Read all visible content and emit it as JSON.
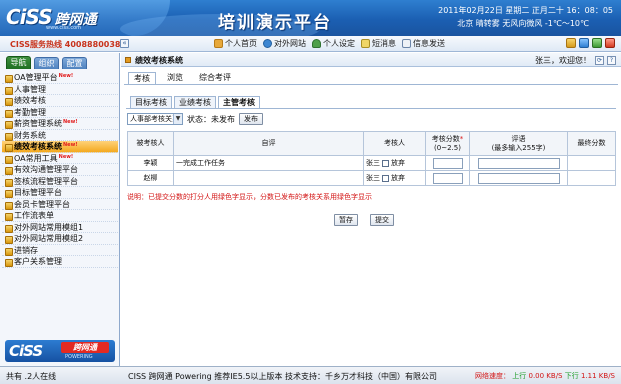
{
  "header": {
    "logo_en": "CiSS",
    "logo_cn": "跨网通",
    "logo_url": "www.ciss.com",
    "platform_title": "培训演示平台",
    "datetime": "2011年02月22日  星期二  正月二十  16：08：05",
    "weather": "北京  晴转雾  无风向微风  -1℃～10℃"
  },
  "toolbar": {
    "hotline": "CISS服务热线  4008880038",
    "collapse": "«",
    "links": [
      {
        "label": "个人首页",
        "icon": "home-icon"
      },
      {
        "label": "对外网站",
        "icon": "globe-icon"
      },
      {
        "label": "个人设定",
        "icon": "user-settings-icon"
      },
      {
        "label": "短消息",
        "icon": "message-icon"
      },
      {
        "label": "信息发送",
        "icon": "mail-icon"
      }
    ]
  },
  "sidebar": {
    "tabs": [
      "导航",
      "组织",
      "配置"
    ],
    "new_tag": "New!",
    "items": [
      {
        "label": "OA管理平台",
        "new": true
      },
      {
        "label": "人事管理"
      },
      {
        "label": "绩效考核"
      },
      {
        "label": "考勤管理"
      },
      {
        "label": "薪资管理系统",
        "new": true
      },
      {
        "label": "财务系统"
      },
      {
        "label": "绩效考核系统",
        "new": true,
        "active": true
      },
      {
        "label": "OA常用工具",
        "new": true
      },
      {
        "label": "有效沟通管理平台"
      },
      {
        "label": "签核流程管理平台"
      },
      {
        "label": "目标管理平台"
      },
      {
        "label": "会员卡管理平台"
      },
      {
        "label": "工作流表单"
      },
      {
        "label": "对外网站常用模组1"
      },
      {
        "label": "对外网站常用模组2"
      },
      {
        "label": "进销存"
      },
      {
        "label": "客户关系管理"
      }
    ],
    "logo_a": "CiSS",
    "logo_b": "跨网通",
    "logo_c": "POWERING"
  },
  "main": {
    "title": "绩效考核系统",
    "welcome": "张三，欢迎您！",
    "header_buttons": [
      "⟳",
      "?"
    ],
    "tabs": [
      "考核",
      "浏览",
      "综合考评"
    ],
    "active_tab": 0,
    "subtabs": [
      "目标考核",
      "业绩考核",
      "主管考核"
    ],
    "active_subtab": 2,
    "filter": {
      "select_value": "人事部考核关系",
      "status_label": "状态：未发布",
      "publish_button": "发布"
    },
    "table": {
      "columns": [
        "被考核人",
        "自评",
        "考核人",
        "考核分数",
        "评语",
        "最终分数"
      ],
      "score_required_mark": "*",
      "score_range": "(0~2.5)",
      "comment_hint": "(最多输入255字)",
      "rows": [
        {
          "name": "李颖",
          "self_eval": "一完成工作任务",
          "reviewer": "张三",
          "waive": "放弃"
        },
        {
          "name": "赵柳",
          "self_eval": "",
          "reviewer": "张三",
          "waive": "放弃"
        }
      ]
    },
    "note": "说明：已提交分数的打分人用绿色字显示，分数已发布的考核关系用绿色字显示",
    "buttons": {
      "save": "暂存",
      "submit": "提交"
    }
  },
  "statusbar": {
    "online": "共有 .2人在线",
    "copyright": "CISS 跨网通 Powering    推荐IE5.5以上版本    技术支持：千乡万才科技（中国）有限公司",
    "speed_label": "网络速度：",
    "up_label": "上行",
    "up_value": "0.00 KB/S",
    "down_label": "下行",
    "down_value": "1.11 KB/S"
  },
  "colors": {
    "header_blue": "#1b5fb2",
    "active_item": "#f4a91f",
    "note_red": "#d31414"
  }
}
